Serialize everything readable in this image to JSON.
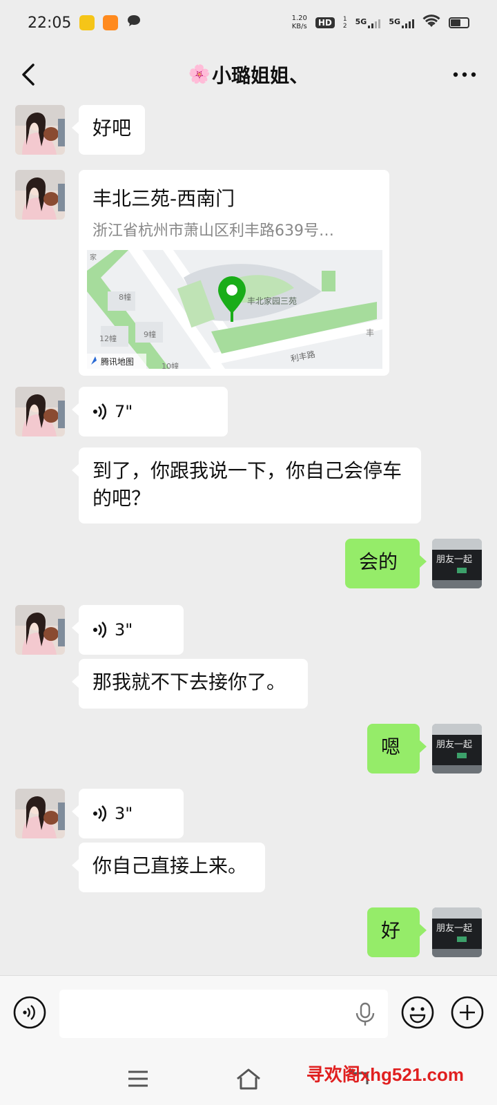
{
  "status_bar": {
    "time": "22:05",
    "net_speed_value": "1.20",
    "net_speed_unit": "KB/s",
    "hd_badge": "HD",
    "sim1_label": "1",
    "sim2_label": "2",
    "signal1": "5G",
    "signal2": "5G"
  },
  "header": {
    "title": "小璐姐姐、",
    "flower_emoji": "🌸"
  },
  "messages": [
    {
      "side": "left",
      "type": "text",
      "text": "好吧"
    },
    {
      "side": "left",
      "type": "location",
      "name": "丰北三苑-西南门",
      "address": "浙江省杭州市萧山区利丰路639号…",
      "map_labels": {
        "place": "丰北家园三苑",
        "road": "利丰路",
        "bld8": "8幢",
        "bld9": "9幢",
        "bld12": "12幢",
        "bld10": "10幢",
        "edge": "丰",
        "corner": "家",
        "provider": "腾讯地图"
      }
    },
    {
      "side": "left",
      "type": "voice",
      "duration": "7\""
    },
    {
      "side": "left",
      "type": "text",
      "text": "到了，你跟我说一下，你自己会停车的吧？"
    },
    {
      "side": "right",
      "type": "text",
      "text": "会的"
    },
    {
      "side": "left",
      "type": "voice",
      "duration": "3\""
    },
    {
      "side": "left",
      "type": "text",
      "text": "那我就不下去接你了。"
    },
    {
      "side": "right",
      "type": "text",
      "text": "嗯"
    },
    {
      "side": "left",
      "type": "voice",
      "duration": "3\""
    },
    {
      "side": "left",
      "type": "text",
      "text": "你自己直接上来。"
    },
    {
      "side": "right",
      "type": "text",
      "text": "好"
    }
  ],
  "my_avatar_sign": "朋友一起",
  "input": {
    "placeholder": ""
  },
  "icons": {
    "back": "chevron-left-icon",
    "more": "more-dots-icon",
    "voice_toggle": "voice-icon",
    "mic": "microphone-icon",
    "emoji": "emoji-icon",
    "add": "plus-icon",
    "nav_menu": "menu-icon",
    "nav_home": "home-icon",
    "nav_back": "return-icon"
  },
  "watermark": "寻欢阁xhg521.com",
  "colors": {
    "my_bubble": "#95ec69",
    "their_bubble": "#ffffff",
    "background": "#ededed",
    "pin": "#1aad19",
    "watermark": "#e02020"
  }
}
